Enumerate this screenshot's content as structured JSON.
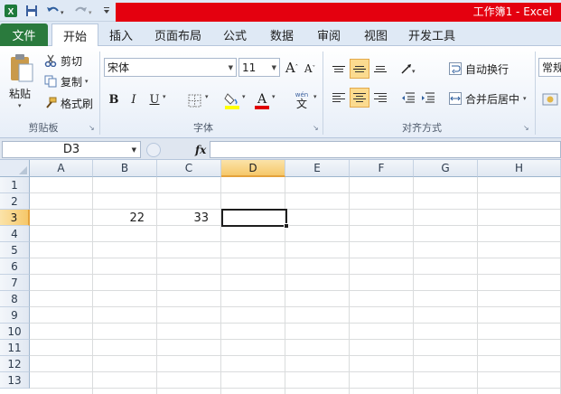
{
  "window": {
    "title": "工作簿1 - Excel"
  },
  "tabs": {
    "file": "文件",
    "home": "开始",
    "insert": "插入",
    "page_layout": "页面布局",
    "formulas": "公式",
    "data": "数据",
    "review": "审阅",
    "view": "视图",
    "developer": "开发工具"
  },
  "clipboard": {
    "paste": "粘贴",
    "cut": "剪切",
    "copy": "复制",
    "format_painter": "格式刷",
    "group_label": "剪贴板"
  },
  "font": {
    "name": "宋体",
    "size": "11",
    "bold": "B",
    "italic": "I",
    "underline": "U",
    "group_label": "字体"
  },
  "alignment": {
    "wrap_text": "自动换行",
    "merge_center": "合并后居中",
    "group_label": "对齐方式"
  },
  "number": {
    "format": "常规"
  },
  "formula_bar": {
    "name_box": "D3",
    "fx": "fx",
    "content": ""
  },
  "sheet": {
    "columns": [
      "A",
      "B",
      "C",
      "D",
      "E",
      "F",
      "G",
      "H"
    ],
    "rows": [
      "1",
      "2",
      "3",
      "4",
      "5",
      "6",
      "7",
      "8",
      "9",
      "10",
      "11",
      "12",
      "13"
    ],
    "selected_cell": "D3",
    "cells": {
      "B3": "22",
      "C3": "33"
    }
  },
  "colors": {
    "file_tab": "#2a7a3d",
    "title_band": "#e4000f",
    "selection_header": "#f6c86a"
  }
}
